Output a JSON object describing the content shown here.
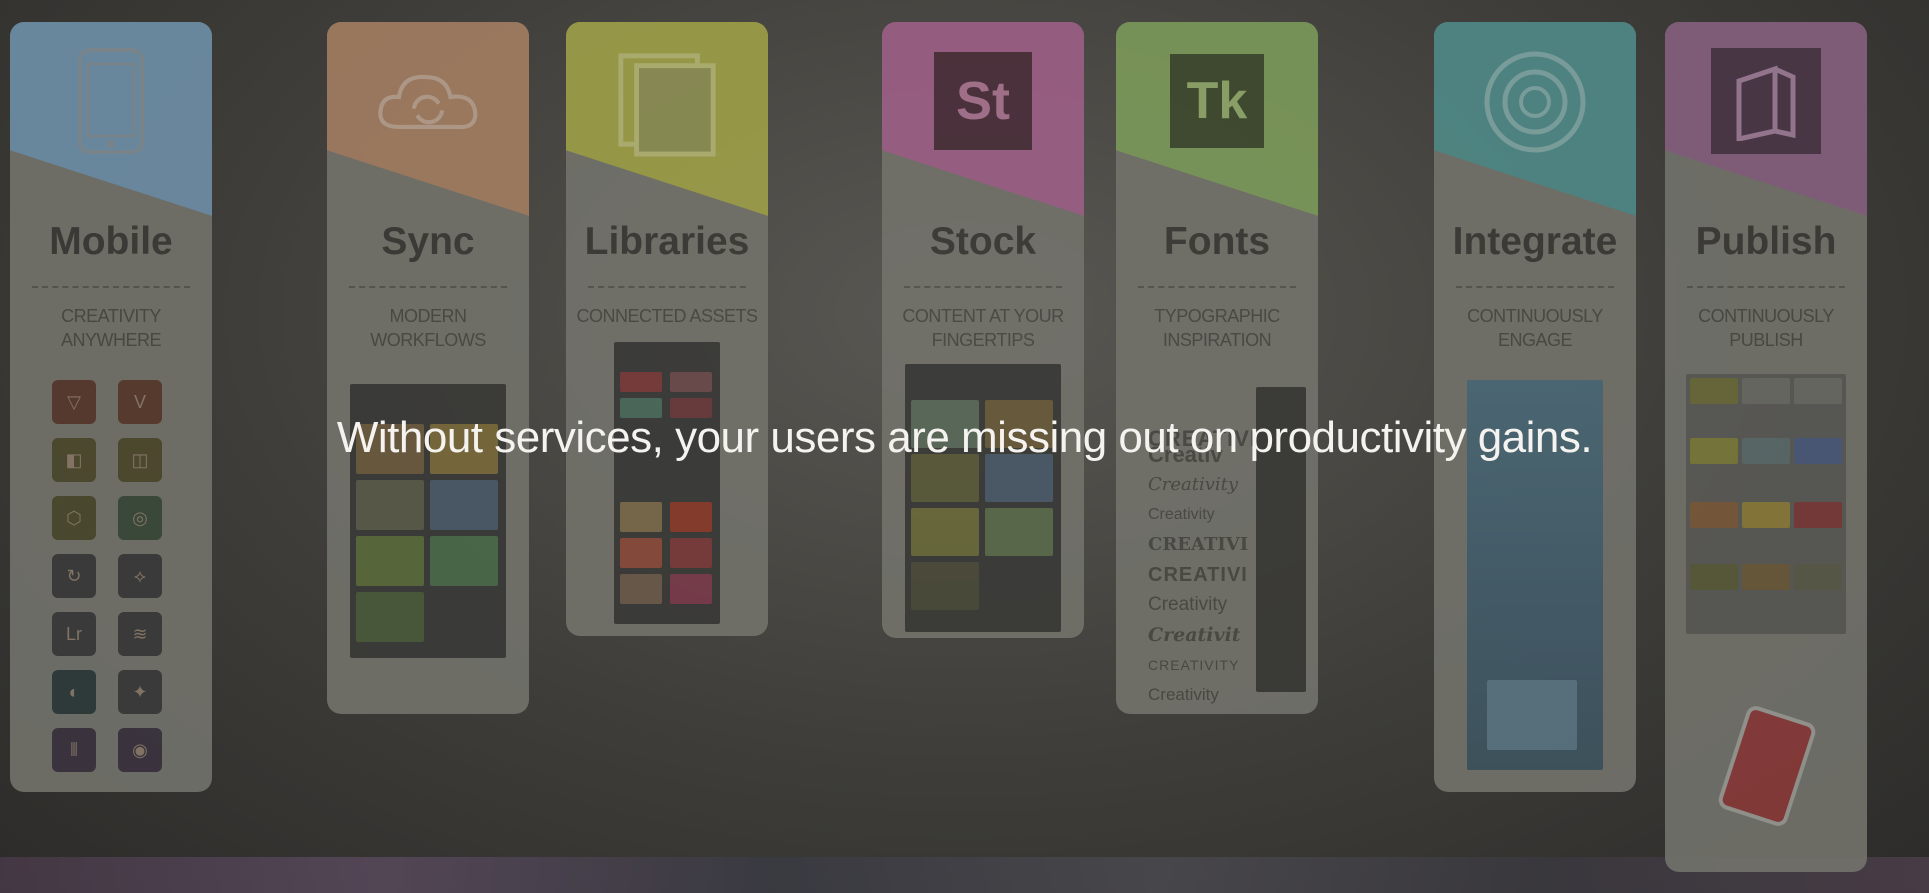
{
  "overlay": {
    "message": "Without services, your users are missing out on productivity gains."
  },
  "cards": [
    {
      "title": "Mobile",
      "subtitle_line1": "Creativity",
      "subtitle_line2": "Anywhere",
      "color": "#6e8fa8"
    },
    {
      "title": "Sync",
      "subtitle_line1": "Modern",
      "subtitle_line2": "Workflows",
      "color": "#a37e62"
    },
    {
      "title": "Libraries",
      "subtitle_line1": "Connected Assets",
      "subtitle_line2": "",
      "color": "#9ea048"
    },
    {
      "title": "Stock",
      "subtitle_line1": "Content at your",
      "subtitle_line2": "fingertips",
      "color": "#9d5f86"
    },
    {
      "title": "Fonts",
      "subtitle_line1": "Typographic",
      "subtitle_line2": "Inspiration",
      "color": "#7c9a5a"
    },
    {
      "title": "Integrate",
      "subtitle_line1": "Continuously",
      "subtitle_line2": "Engage",
      "color": "#4f8a88"
    },
    {
      "title": "Publish",
      "subtitle_line1": "Continuously",
      "subtitle_line2": "Publish",
      "color": "#86607f"
    }
  ],
  "icons": {
    "stock_badge": "St",
    "fonts_badge": "Tk",
    "lightroom_badge": "Lr"
  },
  "font_samples": [
    "CREATIVI",
    "Creativ",
    "Creativity",
    "Creativity",
    "CREATIVI",
    "CREATIVI",
    "Creativity",
    "Creativit",
    "CREATIVITY",
    "Creativity"
  ]
}
